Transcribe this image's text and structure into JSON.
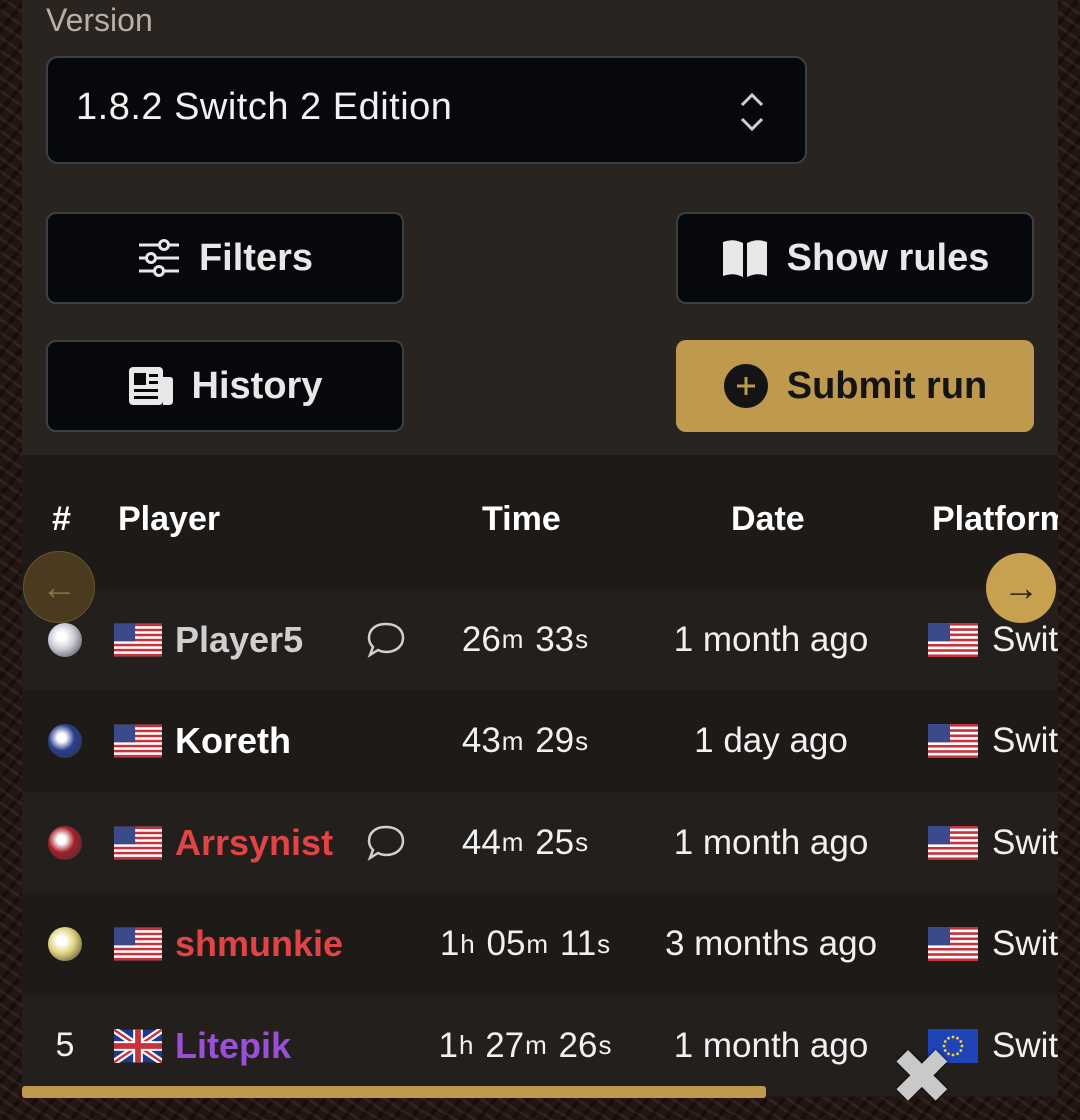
{
  "filters": {
    "version_label": "Version",
    "version_value": "1.8.2 Switch 2 Edition",
    "filters_button": "Filters",
    "show_rules_button": "Show rules",
    "history_button": "History",
    "submit_run_button": "Submit run"
  },
  "table": {
    "headers": {
      "rank": "#",
      "player": "Player",
      "time": "Time",
      "date": "Date",
      "platform": "Platform"
    },
    "rows": [
      {
        "rank": "",
        "trophy": "gold-trophy-icon",
        "country": "US",
        "player": "Player5",
        "color": "#cfcfcf",
        "comment": true,
        "time": {
          "m": "26",
          "s": "33"
        },
        "date": "1 month ago",
        "platform_region": "US",
        "platform": "Switch"
      },
      {
        "rank": "",
        "trophy": "silver-trophy-icon",
        "country": "US",
        "player": "Koreth",
        "color": "#ffffff",
        "comment": false,
        "time": {
          "m": "43",
          "s": "29"
        },
        "date": "1 day ago",
        "platform_region": "US",
        "platform": "Switch"
      },
      {
        "rank": "",
        "trophy": "bronze-trophy-icon",
        "country": "US",
        "player": "Arrsynist",
        "color": "#e04444",
        "comment": true,
        "time": {
          "m": "44",
          "s": "25"
        },
        "date": "1 month ago",
        "platform_region": "US",
        "platform": "Switch"
      },
      {
        "rank": "",
        "trophy": "fourth-place-icon",
        "country": "US",
        "player": "shmunkie",
        "color": "#e04444",
        "comment": false,
        "time": {
          "h": "1",
          "m": "05",
          "s": "11"
        },
        "date": "3 months ago",
        "platform_region": "US",
        "platform": "Switch"
      },
      {
        "rank": "5",
        "trophy": "",
        "country": "GB",
        "player": "Litepik",
        "color": "#9b4fd6",
        "comment": false,
        "time": {
          "h": "1",
          "m": "27",
          "s": "26"
        },
        "date": "1 month ago",
        "platform_region": "EU",
        "platform": "Switch"
      }
    ],
    "time_units": {
      "h": "h",
      "m": "m",
      "s": "s"
    }
  },
  "colors": {
    "accent": "#bf9a4e",
    "panel": "#2a2420",
    "button_bg": "#06080c"
  }
}
